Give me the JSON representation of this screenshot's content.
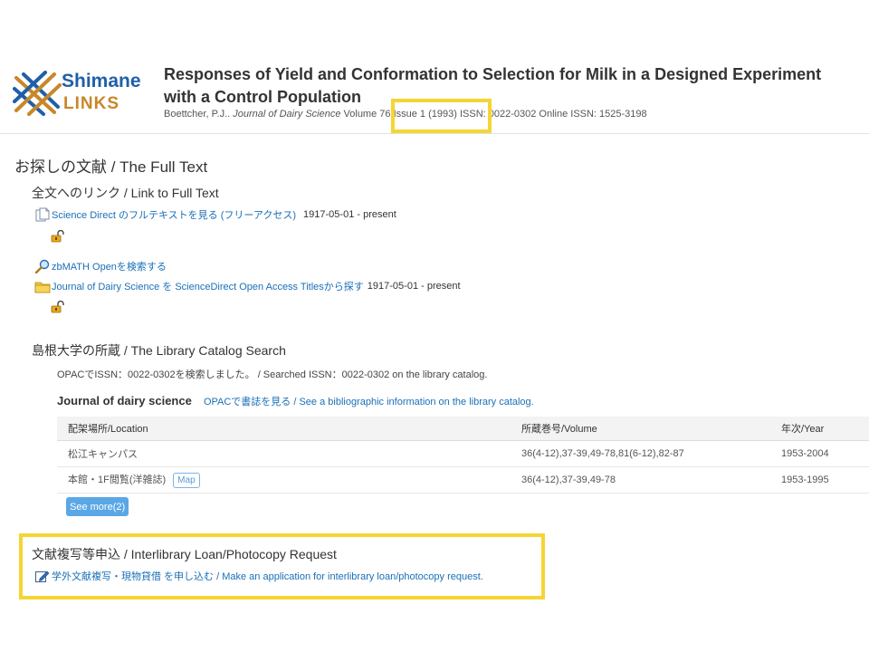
{
  "header": {
    "logo_line1": "Shimane",
    "logo_line2": "LINKS",
    "title": "Responses of Yield and Conformation to Selection for Milk in a Designed Experiment with a Control Population",
    "meta_author": "Boettcher, P.J.. ",
    "meta_journal": "Journal of Dairy Science",
    "meta_volume": " Volume ",
    "meta_issue": "76 Issue 1 (1993)",
    "meta_issn": " ISSN: 0022-0302 Online ISSN: 1525-3198"
  },
  "full_text": {
    "heading": "お探しの文献 / The Full Text",
    "links_heading": "全文へのリンク / Link to Full Text",
    "sciencedirect_link": "Science Direct のフルテキストを見る (フリーアクセス)",
    "sciencedirect_date": "1917-05-01 - present",
    "zbmath_link": "zbMATH Openを検索する",
    "jds_link": "Journal of Dairy Science を ScienceDirect Open Access Titlesから探す",
    "jds_date": "1917-05-01 - present"
  },
  "library": {
    "heading": "島根大学の所蔵 / The Library Catalog Search",
    "opac_note": "OPACでISSN：0022-0302を検索しました。 / Searched ISSN：0022-0302 on the library catalog.",
    "journal_title": "Journal of dairy science",
    "catalog_link": "OPACで書誌を見る / See a bibliographic information on the library catalog.",
    "columns": [
      "配架場所/Location",
      "所蔵巻号/Volume",
      "年次/Year"
    ],
    "rows": [
      [
        "松江キャンパス",
        "36(4-12),37-39,49-78,81(6-12),82-87",
        "1953-2004"
      ],
      [
        "本館・1F閲覧(洋雑誌)",
        "36(4-12),37-39,49-78",
        "1953-1995"
      ]
    ],
    "map_label": "Map",
    "see_more": "See more(2)"
  },
  "ill": {
    "heading": "文献複写等申込 / Interlibrary Loan/Photocopy Request",
    "link": "学外文献複写・現物貸借 を申し込む / Make an application for interlibrary loan/photocopy request."
  },
  "colors": {
    "link": "#1a6fb8",
    "highlight": "#f5d533",
    "logo_blue": "#1f5fa8",
    "logo_orange": "#c8872a",
    "button": "#5aa7e6"
  },
  "icons": [
    "document-icon",
    "lock-open-icon",
    "magnifier-icon",
    "folder-icon",
    "edit-icon"
  ]
}
